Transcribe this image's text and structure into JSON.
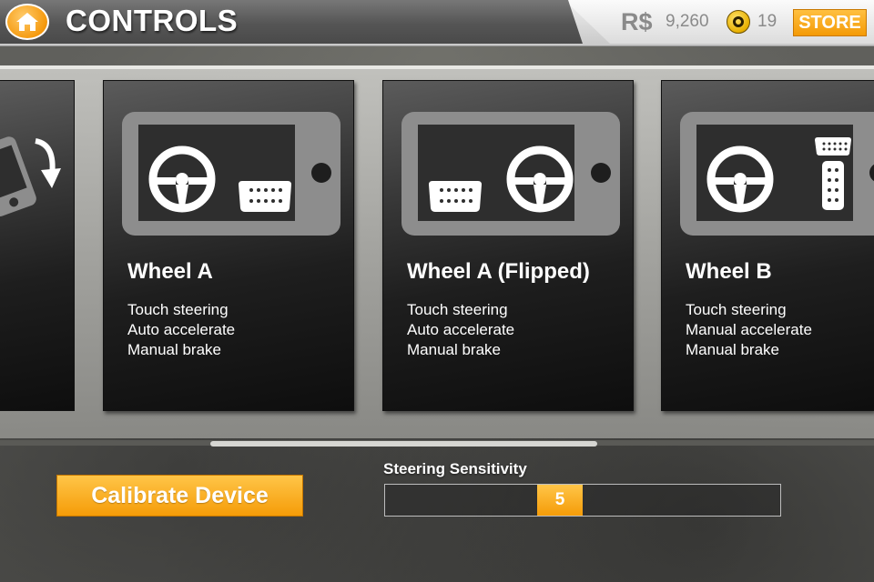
{
  "header": {
    "title": "CONTROLS",
    "currency_label": "R$",
    "currency_value": "9,260",
    "gold_value": "19",
    "store_label": "STORE",
    "home_icon": "home-icon",
    "gold_icon": "gold-coin-icon"
  },
  "cards": [
    {
      "name": "Wheel A",
      "lines": [
        "Touch steering",
        "Auto accelerate",
        "Manual brake"
      ],
      "layout": "wheel-left-pedal-right"
    },
    {
      "name": "Wheel A (Flipped)",
      "lines": [
        "Touch steering",
        "Auto accelerate",
        "Manual brake"
      ],
      "layout": "pedal-left-wheel-right"
    },
    {
      "name": "Wheel B",
      "lines": [
        "Touch steering",
        "Manual accelerate",
        "Manual brake"
      ],
      "layout": "wheel-left-pedals-right"
    }
  ],
  "scroll": {
    "position": 0.42
  },
  "footer": {
    "calibrate_label": "Calibrate Device",
    "sensitivity_label": "Steering Sensitivity",
    "sensitivity_value": "5",
    "sensitivity_fraction": 0.5
  },
  "colors": {
    "accent": "#f59c08",
    "card_bg": "#1e1e1e"
  }
}
